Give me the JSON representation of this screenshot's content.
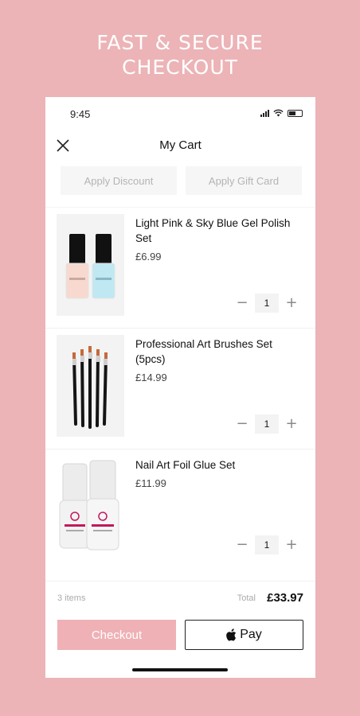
{
  "promo": {
    "line1": "FAST & SECURE",
    "line2": "CHECKOUT"
  },
  "status": {
    "time": "9:45"
  },
  "header": {
    "title": "My Cart",
    "close_icon": "close-icon"
  },
  "actions": {
    "discount_label": "Apply Discount",
    "giftcard_label": "Apply Gift Card"
  },
  "cart": {
    "items": [
      {
        "name": "Light Pink & Sky Blue Gel Polish Set",
        "price": "£6.99",
        "qty": "1",
        "image_icon": "gel-polish-bottles-icon"
      },
      {
        "name": "Professional Art Brushes Set (5pcs)",
        "price": "£14.99",
        "qty": "1",
        "image_icon": "art-brushes-icon"
      },
      {
        "name": "Nail Art Foil Glue Set",
        "price": "£11.99",
        "qty": "1",
        "image_icon": "foil-glue-bottles-icon"
      }
    ],
    "minus": "−",
    "plus": "+"
  },
  "summary": {
    "count": "3 items",
    "total_label": "Total",
    "total": "£33.97"
  },
  "buttons": {
    "checkout": "Checkout",
    "applepay": "Pay"
  },
  "colors": {
    "background": "#ecb4b7",
    "checkout": "#efb1b5"
  }
}
